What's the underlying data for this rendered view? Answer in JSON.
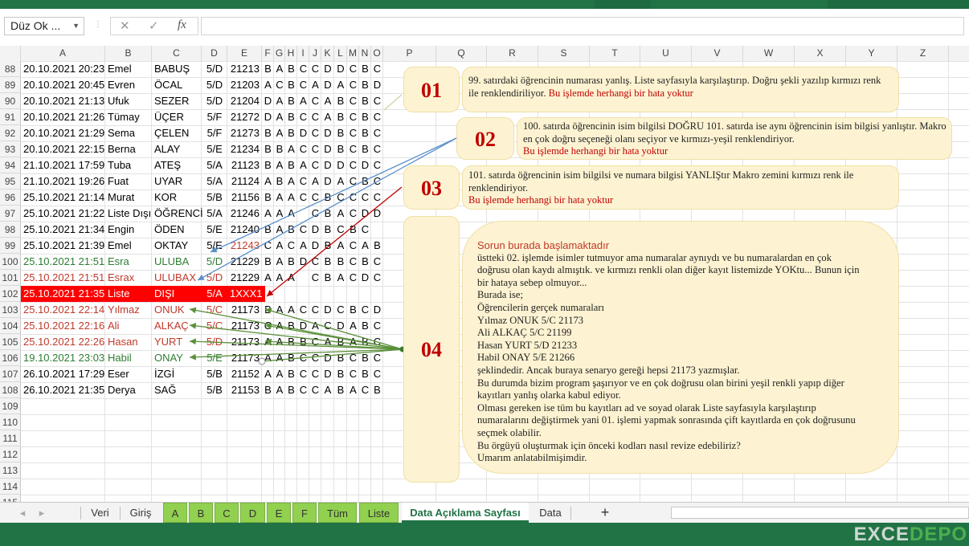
{
  "formula_bar": {
    "name_box": "Düz Ok ...",
    "fx_cancel": "✕",
    "fx_enter": "✓",
    "fx_label": "fx",
    "formula_value": ""
  },
  "columns": [
    "A",
    "B",
    "C",
    "D",
    "E",
    "F",
    "G",
    "H",
    "I",
    "J",
    "K",
    "L",
    "M",
    "N",
    "O",
    "P",
    "Q",
    "R",
    "S",
    "T",
    "U",
    "V",
    "W",
    "X",
    "Y",
    "Z"
  ],
  "rows": [
    {
      "n": "88",
      "a": "20.10.2021 20:23",
      "b": "Emel",
      "c": "BABUŞ",
      "d": "5/D",
      "e": "21213",
      "ans": [
        "B",
        "A",
        "B",
        "C",
        "C",
        "D",
        "D",
        "C",
        "B",
        "C"
      ]
    },
    {
      "n": "89",
      "a": "20.10.2021 20:45",
      "b": "Evren",
      "c": "ÖCAL",
      "d": "5/D",
      "e": "21203",
      "ans": [
        "A",
        "C",
        "B",
        "C",
        "A",
        "D",
        "A",
        "C",
        "B",
        "D"
      ]
    },
    {
      "n": "90",
      "a": "20.10.2021 21:13",
      "b": "Ufuk",
      "c": "SEZER",
      "d": "5/D",
      "e": "21204",
      "ans": [
        "D",
        "A",
        "B",
        "A",
        "C",
        "A",
        "B",
        "C",
        "B",
        "C"
      ]
    },
    {
      "n": "91",
      "a": "20.10.2021 21:26",
      "b": "Tümay",
      "c": "ÜÇER",
      "d": "5/F",
      "e": "21272",
      "ans": [
        "D",
        "A",
        "B",
        "C",
        "C",
        "A",
        "B",
        "C",
        "B",
        "C"
      ]
    },
    {
      "n": "92",
      "a": "20.10.2021 21:29",
      "b": "Sema",
      "c": "ÇELEN",
      "d": "5/F",
      "e": "21273",
      "ans": [
        "B",
        "A",
        "B",
        "D",
        "C",
        "D",
        "B",
        "C",
        "B",
        "C"
      ]
    },
    {
      "n": "93",
      "a": "20.10.2021 22:15",
      "b": "Berna",
      "c": "ALAY",
      "d": "5/E",
      "e": "21234",
      "ans": [
        "B",
        "B",
        "A",
        "C",
        "C",
        "D",
        "B",
        "C",
        "B",
        "C"
      ]
    },
    {
      "n": "94",
      "a": "21.10.2021 17:59",
      "b": "Tuba",
      "c": "ATEŞ",
      "d": "5/A",
      "e": "21123",
      "ans": [
        "B",
        "A",
        "B",
        "A",
        "C",
        "D",
        "D",
        "C",
        "D",
        "C"
      ]
    },
    {
      "n": "95",
      "a": "21.10.2021 19:26",
      "b": " Fuat",
      "c": "UYAR",
      "d": "5/A",
      "e": "21124",
      "ans": [
        "A",
        "B",
        "A",
        "C",
        "A",
        "D",
        "A",
        "C",
        "B",
        "C"
      ]
    },
    {
      "n": "96",
      "a": "25.10.2021 21:14",
      "b": "Murat",
      "c": "KOR",
      "d": "5/B",
      "e": "21156",
      "ans": [
        "B",
        "A",
        "A",
        "C",
        "C",
        "B",
        "C",
        "C",
        "C",
        "C"
      ]
    },
    {
      "n": "97",
      "a": "25.10.2021 21:22",
      "b": "Liste Dışı",
      "c": "ÖĞRENCİ",
      "d": "5/A",
      "e": "21246",
      "ans": [
        "A",
        "A",
        "A",
        "",
        "C",
        "B",
        "A",
        "C",
        "D",
        "D"
      ]
    },
    {
      "n": "98",
      "a": "25.10.2021 21:34",
      "b": "Engin",
      "c": "ÖDEN",
      "d": "5/E",
      "e": "21240",
      "ans": [
        "B",
        "A",
        "B",
        "C",
        "D",
        "B",
        "C",
        "B",
        "C",
        ""
      ]
    },
    {
      "n": "99",
      "a": "25.10.2021 21:39",
      "b": "Emel",
      "c": "OKTAY",
      "d": "5/E",
      "e": "21243",
      "e_red": true,
      "ans": [
        "C",
        "A",
        "C",
        "A",
        "D",
        "B",
        "A",
        "C",
        "A",
        "B"
      ]
    },
    {
      "n": "100",
      "a": "25.10.2021 21:51",
      "b": "Esra",
      "c": "ULUBA",
      "d": "5/D",
      "e": "21229",
      "style": "green",
      "ans": [
        "B",
        "A",
        "B",
        "D",
        "C",
        "B",
        "B",
        "C",
        "B",
        "C"
      ]
    },
    {
      "n": "101",
      "a": "25.10.2021 21:51",
      "b": "Esrax",
      "c": "ULUBAX",
      "d": "5/D",
      "e": "21229",
      "style": "red",
      "ans": [
        "A",
        "A",
        "A",
        "",
        "C",
        "B",
        "A",
        "C",
        "D",
        "C"
      ]
    },
    {
      "n": "102",
      "a": "25.10.2021 21:35",
      "b": "Liste",
      "c": "DIŞI",
      "d": "5/A",
      "e": "1XXX1",
      "style": "redfill",
      "ans": [
        "B",
        "A",
        "B",
        "C",
        "C",
        "A",
        "B",
        "A",
        "B",
        "A"
      ]
    },
    {
      "n": "103",
      "a": "25.10.2021 22:14",
      "b": "Yılmaz",
      "c": "ONUK",
      "d": "5/C",
      "e": "21173",
      "style": "red",
      "ans": [
        "B",
        "A",
        "A",
        "C",
        "C",
        "D",
        "C",
        "B",
        "C",
        "D"
      ]
    },
    {
      "n": "104",
      "a": "25.10.2021 22:16",
      "b": "Ali",
      "c": "ALKAÇ",
      "d": "5/C",
      "e": "21173",
      "style": "red",
      "ans": [
        "C",
        "A",
        "B",
        "D",
        "A",
        "C",
        "D",
        "A",
        "B",
        "C"
      ]
    },
    {
      "n": "105",
      "a": "25.10.2021 22:26",
      "b": "Hasan",
      "c": "YURT",
      "d": "5/D",
      "e": "21173",
      "style": "red",
      "ans": [
        "A",
        "A",
        "B",
        "B",
        "C",
        "A",
        "B",
        "A",
        "B",
        "C"
      ]
    },
    {
      "n": "106",
      "a": "19.10.2021 23:03",
      "b": "Habil",
      "c": "ONAY",
      "d": "5/E",
      "e": "21173",
      "style": "green",
      "ans": [
        "A",
        "A",
        "B",
        "C",
        "C",
        "D",
        "B",
        "C",
        "B",
        "C"
      ]
    },
    {
      "n": "107",
      "a": "26.10.2021 17:29",
      "b": "Eser",
      "c": "İZGİ",
      "d": "5/B",
      "e": "21152",
      "ans": [
        "A",
        "A",
        "B",
        "C",
        "C",
        "D",
        "B",
        "C",
        "B",
        "C"
      ]
    },
    {
      "n": "108",
      "a": "26.10.2021 21:35",
      "b": "Derya",
      "c": "SAĞ",
      "d": "5/B",
      "e": "21153",
      "ans": [
        "B",
        "A",
        "B",
        "C",
        "C",
        "A",
        "B",
        "A",
        "C",
        "B"
      ]
    },
    {
      "n": "109"
    },
    {
      "n": "110"
    },
    {
      "n": "111"
    },
    {
      "n": "112"
    },
    {
      "n": "113"
    },
    {
      "n": "114"
    },
    {
      "n": "115"
    }
  ],
  "callouts": {
    "c01": {
      "num": "01",
      "text": "99. satırdaki öğrencinin numarası yanlış. Liste sayfasıyla karşılaştırıp. Doğru şekli yazılıp kırmızı renk ile renklendiriliyor.",
      "hl": "Bu işlemde herhangi bir hata yoktur"
    },
    "c02": {
      "num": "02",
      "text": "100. satırda öğrencinin isim bilgilsi DOĞRU 101. satırda ise aynı öğrencinin isim bilgisi yanlıştır. Makro en çok doğru seçeneği olanı seçiyor ve kırmızı-yeşil renklendiriyor.",
      "hl": "Bu işlemde herhangi bir hata yoktur"
    },
    "c03": {
      "num": "03",
      "text": "101. satırda öğrencinin isim bilgilsi ve numara bilgisi YANLIŞtır Makro zemini kırmızı renk ile renklendiriyor.",
      "hl": "Bu işlemde herhangi bir hata yoktur"
    },
    "c04": {
      "num": "04",
      "head": "Sorun burada başlamaktadır",
      "lines": [
        "üstteki 02. işlemde isimler tutmuyor ama numaralar aynıydı ve bu numaralardan en çok",
        "doğrusu olan kaydı almıştık. ve kırmızı renkli olan diğer kayıt listemizde YOKtu... Bunun için",
        "bir hataya sebep olmuyor...",
        "Burada ise;",
        "Öğrencilerin gerçek numaraları",
        "Yılmaz ONUK 5/C 21173",
        "Ali ALKAÇ 5/C 21199",
        "Hasan YURT 5/D 21233",
        "Habil ONAY 5/E 21266",
        "şeklindedir. Ancak buraya senaryo gereği hepsi 21173 yazmışlar.",
        "Bu durumda bizim program şaşırıyor ve en çok doğrusu olan birini yeşil renkli yapıp diğer",
        "kayıtları yanlış olarka kabul ediyor.",
        "Olması gereken ise tüm bu kayıtları ad ve soyad olarak Liste sayfasıyla karşılaştırıp",
        "numaralarını değiştirmek yani 01. işlemi yapmak sonrasında çift kayıtlarda en çok doğrusunu",
        "seçmek olabilir.",
        "Bu örgüyü oluşturmak için önceki kodları nasıl revize edebiliriz?",
        "Umarım anlatabilmişimdir."
      ]
    }
  },
  "tabs": {
    "prev": "◂",
    "next": "▸",
    "veri": "Veri",
    "giris": "Giriş",
    "a": "A",
    "b": "B",
    "c": "C",
    "d": "D",
    "e": "E",
    "f": "F",
    "tum": "Tüm",
    "liste": "Liste",
    "active": "Data Açıklama Sayfası",
    "data": "Data",
    "add": "+"
  },
  "watermark": {
    "a": "EXCE",
    "b": "DEPO"
  }
}
